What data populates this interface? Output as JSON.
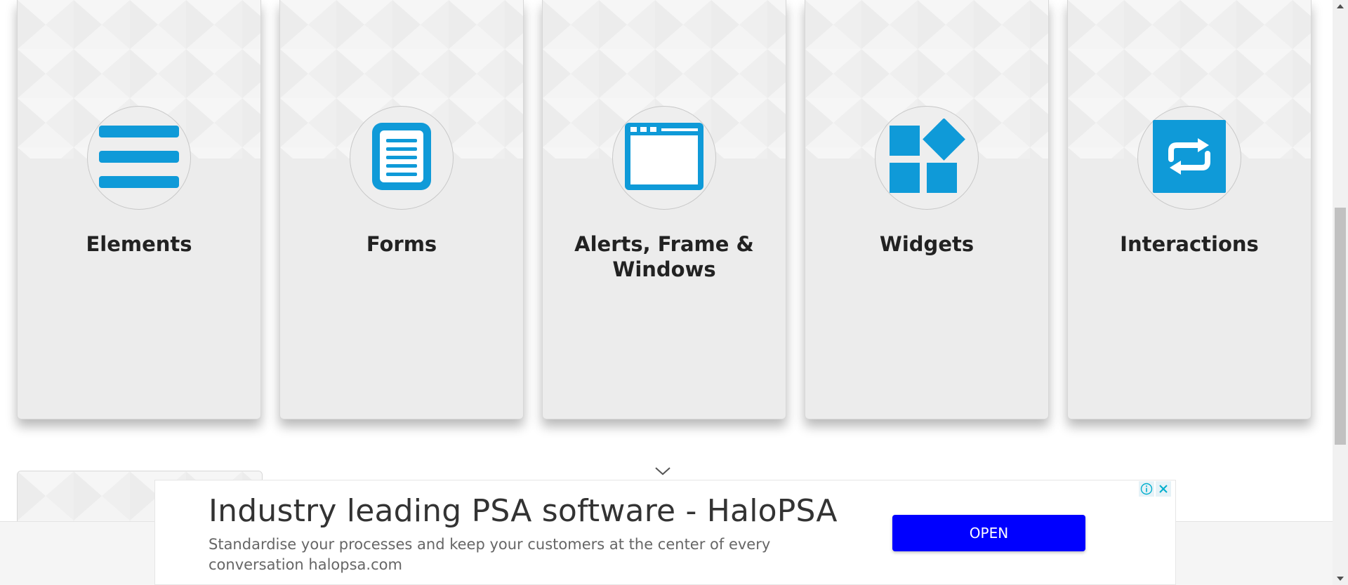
{
  "cards": [
    {
      "title": "Elements",
      "icon": "list-icon"
    },
    {
      "title": "Forms",
      "icon": "document-icon"
    },
    {
      "title": "Alerts, Frame & Windows",
      "icon": "browser-window-icon"
    },
    {
      "title": "Widgets",
      "icon": "widgets-grid-icon"
    },
    {
      "title": "Interactions",
      "icon": "repeat-arrows-icon"
    }
  ],
  "colors": {
    "icon_blue": "#0f9ad8",
    "card_bg": "#ececec",
    "ad_button": "#0000ff"
  },
  "ad": {
    "headline": "Industry leading PSA software - HaloPSA",
    "description": "Standardise your processes and keep your customers at the center of every conversation halopsa.com",
    "button_label": "OPEN",
    "info_icon": "info-icon",
    "close_icon": "close-icon"
  }
}
